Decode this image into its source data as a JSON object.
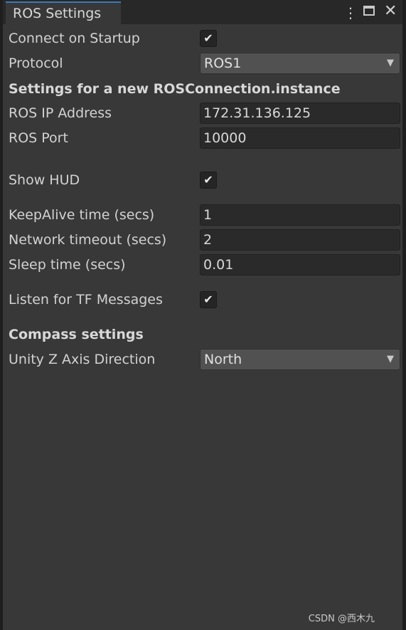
{
  "window": {
    "title": "ROS Settings",
    "menu_icon": "kebab-menu-icon",
    "maximize_icon": "maximize-icon",
    "close_icon": "close-icon"
  },
  "fields": {
    "connect_on_startup": {
      "label": "Connect on Startup",
      "checked": true
    },
    "protocol": {
      "label": "Protocol",
      "value": "ROS1"
    },
    "section_new_connection": "Settings for a new ROSConnection.instance",
    "ros_ip": {
      "label": "ROS IP Address",
      "value": "172.31.136.125"
    },
    "ros_port": {
      "label": "ROS Port",
      "value": "10000"
    },
    "show_hud": {
      "label": "Show HUD",
      "checked": true
    },
    "keepalive": {
      "label": "KeepAlive time (secs)",
      "value": "1"
    },
    "network_timeout": {
      "label": "Network timeout (secs)",
      "value": "2"
    },
    "sleep_time": {
      "label": "Sleep time (secs)",
      "value": "0.01"
    },
    "listen_tf": {
      "label": "Listen for TF Messages",
      "checked": true
    },
    "section_compass": "Compass settings",
    "unity_z": {
      "label": "Unity Z Axis Direction",
      "value": "North"
    }
  },
  "watermark": "CSDN @西木九"
}
